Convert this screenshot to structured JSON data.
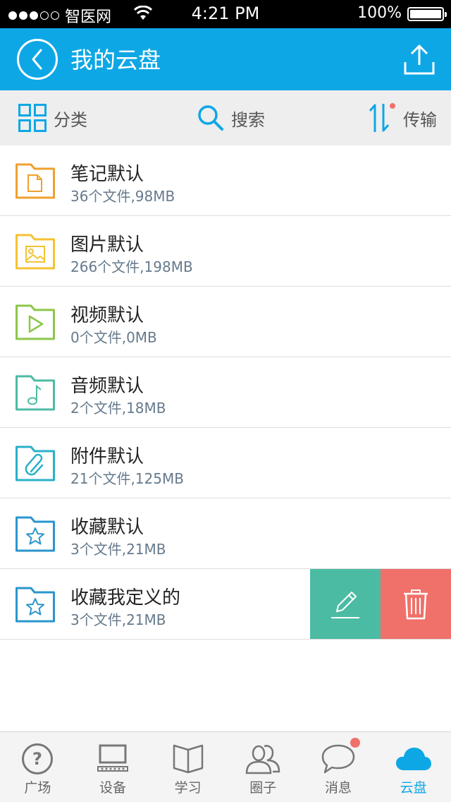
{
  "status_bar": {
    "carrier": "智医网",
    "time": "4:21 PM",
    "battery": "100%"
  },
  "nav": {
    "title": "我的云盘"
  },
  "toolbar": {
    "category": "分类",
    "search": "搜索",
    "transfer": "传输"
  },
  "files": [
    {
      "name": "笔记默认",
      "meta": "36个文件,98MB",
      "icon": "note-folder-icon",
      "color": "#f0a030"
    },
    {
      "name": "图片默认",
      "meta": "266个文件,198MB",
      "icon": "image-folder-icon",
      "color": "#f5c232"
    },
    {
      "name": "视频默认",
      "meta": "0个文件,0MB",
      "icon": "video-folder-icon",
      "color": "#8cc64a"
    },
    {
      "name": "音频默认",
      "meta": "2个文件,18MB",
      "icon": "audio-folder-icon",
      "color": "#4cbba3"
    },
    {
      "name": "附件默认",
      "meta": "21个文件,125MB",
      "icon": "attachment-folder-icon",
      "color": "#2ab0c8"
    },
    {
      "name": "收藏默认",
      "meta": "3个文件,21MB",
      "icon": "favorite-folder-icon",
      "color": "#2a96cc"
    },
    {
      "name": "收藏我定义的",
      "meta": "3个文件,21MB",
      "icon": "favorite-folder-icon",
      "color": "#2a96cc"
    }
  ],
  "tabs": [
    {
      "label": "广场",
      "icon": "help-circle-icon"
    },
    {
      "label": "设备",
      "icon": "device-icon"
    },
    {
      "label": "学习",
      "icon": "book-icon"
    },
    {
      "label": "圈子",
      "icon": "people-icon"
    },
    {
      "label": "消息",
      "icon": "chat-bubble-icon"
    },
    {
      "label": "云盘",
      "icon": "cloud-icon"
    }
  ],
  "colors": {
    "accent": "#0ea7e6",
    "edit": "#4cbba3",
    "delete": "#f0716a"
  }
}
